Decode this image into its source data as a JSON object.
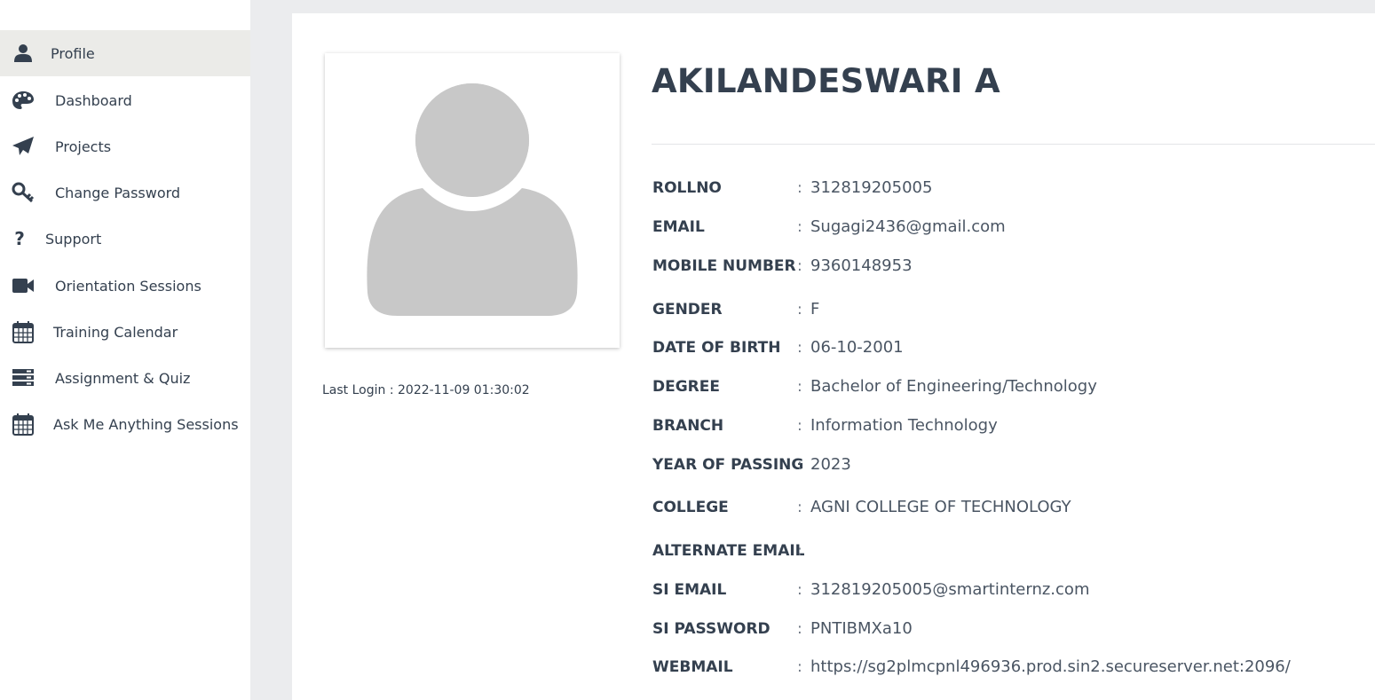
{
  "sidebar": {
    "items": [
      {
        "label": "Profile",
        "icon": "user-icon"
      },
      {
        "label": "Dashboard",
        "icon": "palette-icon"
      },
      {
        "label": "Projects",
        "icon": "paper-plane-icon"
      },
      {
        "label": "Change Password",
        "icon": "key-icon"
      },
      {
        "label": "Support",
        "icon": "question-icon"
      },
      {
        "label": "Orientation Sessions",
        "icon": "video-camera-icon"
      },
      {
        "label": "Training Calendar",
        "icon": "calendar-icon"
      },
      {
        "label": "Assignment & Quiz",
        "icon": "server-icon"
      },
      {
        "label": "Ask Me Anything Sessions",
        "icon": "calendar-icon"
      }
    ],
    "active_index": 0
  },
  "profile": {
    "name": "AKILANDESWARI A",
    "last_login": "Last Login : 2022-11-09 01:30:02",
    "avatar_icon": "default-avatar-icon",
    "colon": ":",
    "fields": [
      {
        "label": "ROLLNO",
        "value": "312819205005"
      },
      {
        "label": "EMAIL",
        "value": "Sugagi2436@gmail.com"
      },
      {
        "label": "MOBILE NUMBER",
        "value": "9360148953"
      },
      {
        "label": "GENDER",
        "value": "F"
      },
      {
        "label": "DATE OF BIRTH",
        "value": "06-10-2001"
      },
      {
        "label": "DEGREE",
        "value": "Bachelor of Engineering/Technology"
      },
      {
        "label": "BRANCH",
        "value": "Information Technology"
      },
      {
        "label": "YEAR OF PASSING",
        "value": "2023"
      },
      {
        "label": "COLLEGE",
        "value": "AGNI COLLEGE OF TECHNOLOGY"
      },
      {
        "label": "ALTERNATE EMAIL",
        "value": ""
      },
      {
        "label": "SI EMAIL",
        "value": "312819205005@smartinternz.com"
      },
      {
        "label": "SI PASSWORD",
        "value": "PNTIBMXa10"
      },
      {
        "label": "WEBMAIL",
        "value": "https://sg2plmcpnl496936.prod.sin2.secureserver.net:2096/"
      }
    ]
  },
  "colors": {
    "text": "#34404f",
    "active_bg": "#ebebe8",
    "page_bg": "#ebecee",
    "avatar": "#c8c8c8"
  }
}
